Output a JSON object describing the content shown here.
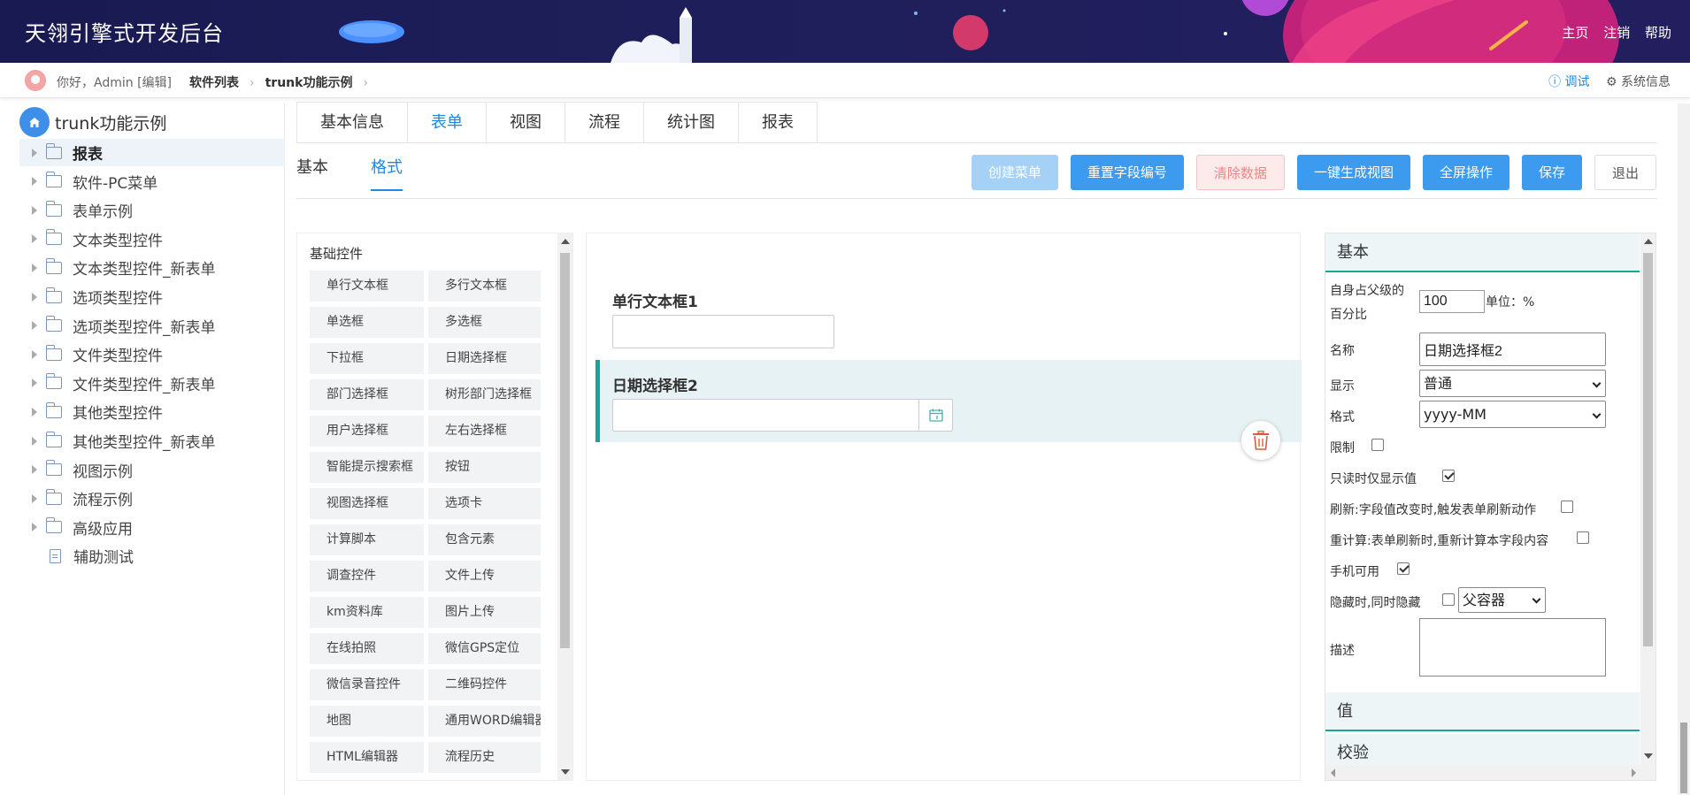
{
  "header": {
    "app_title": "天翎引擎式开发后台",
    "links": [
      "主页",
      "注销",
      "帮助"
    ]
  },
  "breadcrumb": {
    "greeting": "你好，Admin [编辑]",
    "items": [
      "软件列表",
      "trunk功能示例"
    ],
    "debug": "调试",
    "system_info": "系统信息"
  },
  "tree": {
    "root": "trunk功能示例",
    "items": [
      {
        "label": "报表",
        "type": "folder",
        "active": true
      },
      {
        "label": "软件-PC菜单",
        "type": "folder"
      },
      {
        "label": "表单示例",
        "type": "folder"
      },
      {
        "label": "文本类型控件",
        "type": "folder"
      },
      {
        "label": "文本类型控件_新表单",
        "type": "folder"
      },
      {
        "label": "选项类型控件",
        "type": "folder"
      },
      {
        "label": "选项类型控件_新表单",
        "type": "folder"
      },
      {
        "label": "文件类型控件",
        "type": "folder"
      },
      {
        "label": "文件类型控件_新表单",
        "type": "folder"
      },
      {
        "label": "其他类型控件",
        "type": "folder"
      },
      {
        "label": "其他类型控件_新表单",
        "type": "folder"
      },
      {
        "label": "视图示例",
        "type": "folder"
      },
      {
        "label": "流程示例",
        "type": "folder"
      },
      {
        "label": "高级应用",
        "type": "folder"
      },
      {
        "label": "辅助测试",
        "type": "doc"
      }
    ]
  },
  "tabs": [
    "基本信息",
    "表单",
    "视图",
    "流程",
    "统计图",
    "报表"
  ],
  "active_tab": "表单",
  "subtabs": [
    "基本",
    "格式"
  ],
  "active_subtab": "格式",
  "toolbar": {
    "create_menu": "创建菜单",
    "reset_field_no": "重置字段编号",
    "clear_data": "清除数据",
    "gen_view": "一键生成视图",
    "fullscreen": "全屏操作",
    "save": "保存",
    "exit": "退出"
  },
  "palette": {
    "heading": "基础控件",
    "items": [
      "单行文本框",
      "多行文本框",
      "单选框",
      "多选框",
      "下拉框",
      "日期选择框",
      "部门选择框",
      "树形部门选择框",
      "用户选择框",
      "左右选择框",
      "智能提示搜索框",
      "按钮",
      "视图选择框",
      "选项卡",
      "计算脚本",
      "包含元素",
      "调查控件",
      "文件上传",
      "km资料库",
      "图片上传",
      "在线拍照",
      "微信GPS定位",
      "微信录音控件",
      "二维码控件",
      "地图",
      "通用WORD编辑器",
      "HTML编辑器",
      "流程历史"
    ]
  },
  "canvas": {
    "field1_label": "单行文本框1",
    "field2_label": "日期选择框2"
  },
  "props": {
    "sec_basic": "基本",
    "percent_label_1": "自身占父级的",
    "percent_label_2": "百分比",
    "percent_value": "100",
    "unit_label": "单位：%",
    "name_label": "名称",
    "name_value": "日期选择框2",
    "display_label": "显示",
    "display_value": "普通",
    "format_label": "格式",
    "format_value": "yyyy-MM",
    "limit_label": "限制",
    "readonly_label": "只读时仅显示值",
    "refresh_label": "刷新:字段值改变时,触发表单刷新动作",
    "recalc_label": "重计算:表单刷新时,重新计算本字段内容",
    "mobile_label": "手机可用",
    "hide_label": "隐藏时,同时隐藏",
    "hide_select": "父容器",
    "desc_label": "描述",
    "sec_value": "值",
    "sec_validate": "校验",
    "checks": {
      "limit": false,
      "readonly": true,
      "refresh": false,
      "recalc": false,
      "mobile": true,
      "hide": false
    }
  }
}
